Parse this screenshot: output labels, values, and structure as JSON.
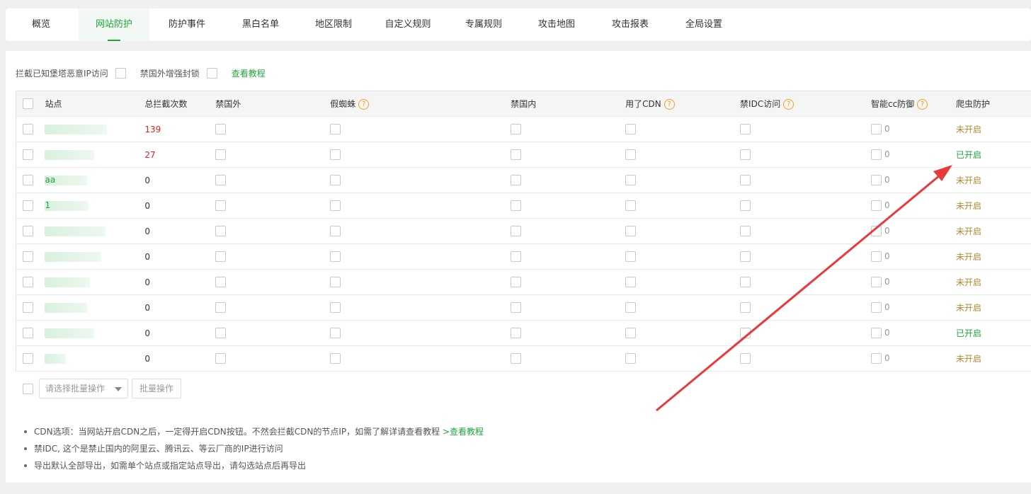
{
  "tabs": [
    {
      "label": "概览",
      "active": false
    },
    {
      "label": "网站防护",
      "active": true
    },
    {
      "label": "防护事件",
      "active": false
    },
    {
      "label": "黑白名单",
      "active": false
    },
    {
      "label": "地区限制",
      "active": false
    },
    {
      "label": "自定义规则",
      "active": false
    },
    {
      "label": "专属规则",
      "active": false
    },
    {
      "label": "攻击地图",
      "active": false
    },
    {
      "label": "攻击报表",
      "active": false
    },
    {
      "label": "全局设置",
      "active": false
    }
  ],
  "options": {
    "block_bastion_label": "拦截已知堡塔恶意IP访问",
    "foreign_lock_label": "禁国外增强封锁",
    "tutorial_link": "查看教程"
  },
  "table": {
    "headers": {
      "site": "站点",
      "total_blocks": "总拦截次数",
      "ban_foreign": "禁国外",
      "fake_spider": "假蜘蛛",
      "ban_domestic": "禁国内",
      "cdn": "用了CDN",
      "ban_idc": "禁IDC访问",
      "smart_cc": "智能cc防御",
      "crawler": "爬虫防护"
    },
    "help_icon": "?",
    "rows": [
      {
        "site": "",
        "count": "139",
        "cc": "0",
        "status": "未开启",
        "on": false
      },
      {
        "site": "",
        "count": "27",
        "cc": "0",
        "status": "已开启",
        "on": true
      },
      {
        "site": "aa",
        "count": "0",
        "cc": "0",
        "status": "未开启",
        "on": false
      },
      {
        "site": "1",
        "count": "0",
        "cc": "0",
        "status": "未开启",
        "on": false
      },
      {
        "site": "",
        "count": "0",
        "cc": "0",
        "status": "未开启",
        "on": false
      },
      {
        "site": "",
        "count": "0",
        "cc": "0",
        "status": "未开启",
        "on": false
      },
      {
        "site": "",
        "count": "0",
        "cc": "0",
        "status": "未开启",
        "on": false
      },
      {
        "site": "",
        "count": "0",
        "cc": "0",
        "status": "未开启",
        "on": false
      },
      {
        "site": "",
        "count": "0",
        "cc": "0",
        "status": "已开启",
        "on": true
      },
      {
        "site": "",
        "count": "0",
        "cc": "0",
        "status": "未开启",
        "on": false
      }
    ]
  },
  "bulk": {
    "select_placeholder": "请选择批量操作",
    "button_label": "批量操作"
  },
  "notes": [
    {
      "text": "CDN选项：当网站开启CDN之后，一定得开启CDN按钮。不然会拦截CDN的节点IP，如需了解详请查看教程 ",
      "link": ">查看教程"
    },
    {
      "text": "禁IDC, 这个是禁止国内的阿里云、腾讯云、等云厂商的IP进行访问",
      "link": ""
    },
    {
      "text": "导出默认全部导出，如需单个站点或指定站点导出，请勾选站点后再导出",
      "link": ""
    }
  ],
  "colors": {
    "accent": "#20a53a",
    "danger": "#e02020",
    "off": "#b08a30",
    "arrow": "#e83a3a"
  }
}
